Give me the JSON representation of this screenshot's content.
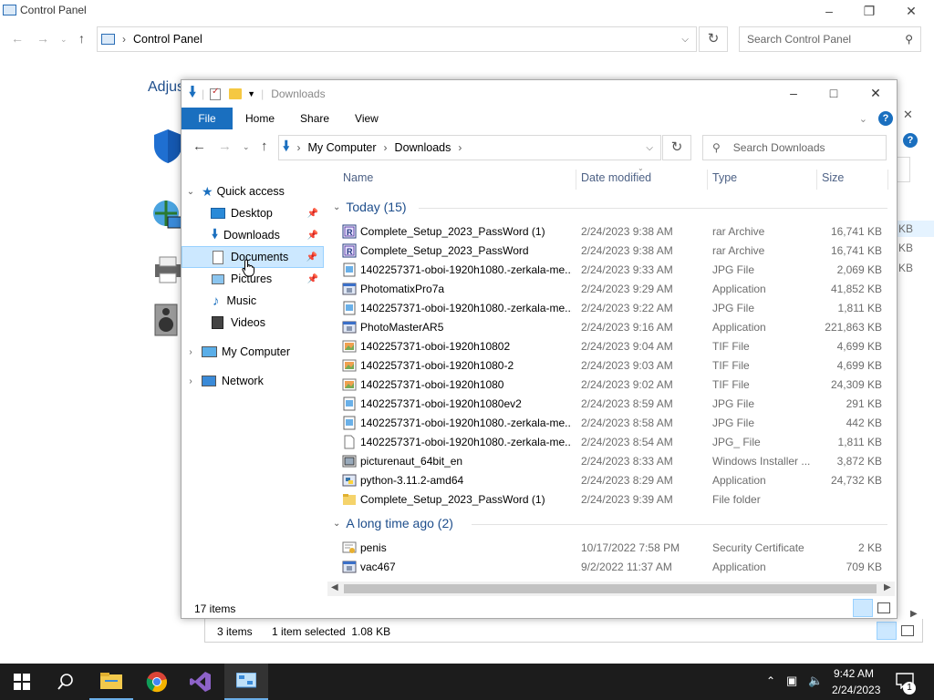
{
  "control_panel": {
    "title": "Control Panel",
    "address": "Control Panel",
    "search_placeholder": "Search Control Panel",
    "heading_partial": "Adjus",
    "status_items": "3 items",
    "status_selected": "1 item selected  1.08 KB",
    "size_partials": [
      "KB",
      "KB",
      "KB"
    ]
  },
  "explorer": {
    "title": "Downloads",
    "ribbon_tabs": [
      "File",
      "Home",
      "Share",
      "View"
    ],
    "address": {
      "crumbs": [
        "My Computer",
        "Downloads"
      ]
    },
    "search_placeholder": "Search Downloads",
    "nav": {
      "quick_access": "Quick access",
      "items": [
        {
          "label": "Desktop",
          "icon": "desktop-icon",
          "pinned": true
        },
        {
          "label": "Downloads",
          "icon": "downloads-icon",
          "pinned": true
        },
        {
          "label": "Documents",
          "icon": "documents-icon",
          "pinned": true,
          "selected": true
        },
        {
          "label": "Pictures",
          "icon": "pictures-icon",
          "pinned": true
        },
        {
          "label": "Music",
          "icon": "music-icon",
          "pinned": false
        },
        {
          "label": "Videos",
          "icon": "videos-icon",
          "pinned": false
        }
      ],
      "my_computer": "My Computer",
      "network": "Network"
    },
    "columns": {
      "name": "Name",
      "date": "Date modified",
      "type": "Type",
      "size": "Size"
    },
    "groups": [
      {
        "label": "Today (15)",
        "files": [
          {
            "name": "Complete_Setup_2023_PassWord (1)",
            "date": "2/24/2023 9:38 AM",
            "type": "rar Archive",
            "size": "16,741 KB",
            "icon": "rar"
          },
          {
            "name": "Complete_Setup_2023_PassWord",
            "date": "2/24/2023 9:38 AM",
            "type": "rar Archive",
            "size": "16,741 KB",
            "icon": "rar"
          },
          {
            "name": "1402257371-oboi-1920h1080.-zerkala-me...",
            "date": "2/24/2023 9:33 AM",
            "type": "JPG File",
            "size": "2,069 KB",
            "icon": "jpg"
          },
          {
            "name": "PhotomatixPro7a",
            "date": "2/24/2023 9:29 AM",
            "type": "Application",
            "size": "41,852 KB",
            "icon": "app"
          },
          {
            "name": "1402257371-oboi-1920h1080.-zerkala-me...",
            "date": "2/24/2023 9:22 AM",
            "type": "JPG File",
            "size": "1,811 KB",
            "icon": "jpg"
          },
          {
            "name": "PhotoMasterAR5",
            "date": "2/24/2023 9:16 AM",
            "type": "Application",
            "size": "221,863 KB",
            "icon": "app"
          },
          {
            "name": "1402257371-oboi-1920h10802",
            "date": "2/24/2023 9:04 AM",
            "type": "TIF File",
            "size": "4,699 KB",
            "icon": "tif"
          },
          {
            "name": "1402257371-oboi-1920h1080-2",
            "date": "2/24/2023 9:03 AM",
            "type": "TIF File",
            "size": "4,699 KB",
            "icon": "tif"
          },
          {
            "name": "1402257371-oboi-1920h1080",
            "date": "2/24/2023 9:02 AM",
            "type": "TIF File",
            "size": "24,309 KB",
            "icon": "tif"
          },
          {
            "name": "1402257371-oboi-1920h1080ev2",
            "date": "2/24/2023 8:59 AM",
            "type": "JPG File",
            "size": "291 KB",
            "icon": "jpg"
          },
          {
            "name": "1402257371-oboi-1920h1080.-zerkala-me...",
            "date": "2/24/2023 8:58 AM",
            "type": "JPG File",
            "size": "442 KB",
            "icon": "jpg"
          },
          {
            "name": "1402257371-oboi-1920h1080.-zerkala-me...",
            "date": "2/24/2023 8:54 AM",
            "type": "JPG_ File",
            "size": "1,811 KB",
            "icon": "blank"
          },
          {
            "name": "picturenaut_64bit_en",
            "date": "2/24/2023 8:33 AM",
            "type": "Windows Installer ...",
            "size": "3,872 KB",
            "icon": "msi"
          },
          {
            "name": "python-3.11.2-amd64",
            "date": "2/24/2023 8:29 AM",
            "type": "Application",
            "size": "24,732 KB",
            "icon": "py"
          },
          {
            "name": "Complete_Setup_2023_PassWord (1)",
            "date": "2/24/2023 9:39 AM",
            "type": "File folder",
            "size": "",
            "icon": "folder"
          }
        ]
      },
      {
        "label": "A long time ago (2)",
        "files": [
          {
            "name": "penis",
            "date": "10/17/2022 7:58 PM",
            "type": "Security Certificate",
            "size": "2 KB",
            "icon": "cert"
          },
          {
            "name": "vac467",
            "date": "9/2/2022 11:37 AM",
            "type": "Application",
            "size": "709 KB",
            "icon": "app"
          }
        ]
      }
    ],
    "status": "17 items"
  },
  "taskbar": {
    "time": "9:42 AM",
    "date": "2/24/2023",
    "notification_count": "1"
  }
}
